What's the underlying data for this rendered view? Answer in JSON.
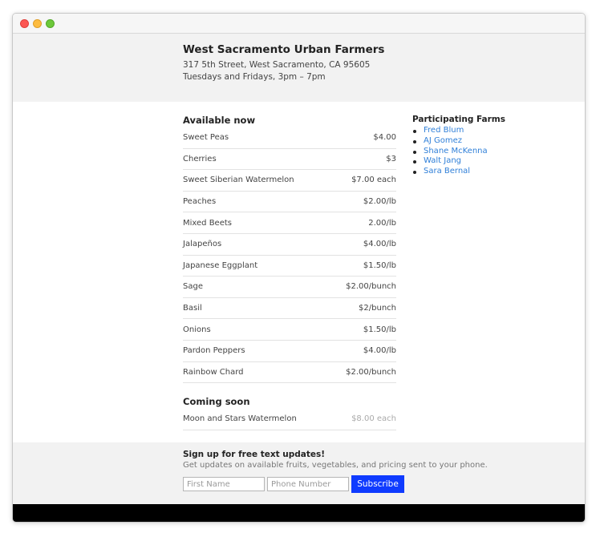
{
  "header": {
    "title": "West Sacramento Urban Farmers",
    "address": "317 5th Street, West Sacramento, CA 95605",
    "hours": "Tuesdays and Fridays, 3pm – 7pm"
  },
  "available": {
    "title": "Available now",
    "items": [
      {
        "name": "Sweet Peas",
        "price": "$4.00"
      },
      {
        "name": "Cherries",
        "price": "$3"
      },
      {
        "name": "Sweet Siberian Watermelon",
        "price": "$7.00 each"
      },
      {
        "name": "Peaches",
        "price": "$2.00/lb"
      },
      {
        "name": "Mixed Beets",
        "price": "2.00/lb"
      },
      {
        "name": "Jalapeños",
        "price": "$4.00/lb"
      },
      {
        "name": "Japanese Eggplant",
        "price": "$1.50/lb"
      },
      {
        "name": "Sage",
        "price": "$2.00/bunch"
      },
      {
        "name": "Basil",
        "price": "$2/bunch"
      },
      {
        "name": "Onions",
        "price": "$1.50/lb"
      },
      {
        "name": "Pardon Peppers",
        "price": "$4.00/lb"
      },
      {
        "name": "Rainbow Chard",
        "price": "$2.00/bunch"
      }
    ]
  },
  "coming_soon": {
    "title": "Coming soon",
    "items": [
      {
        "name": "Moon and Stars Watermelon",
        "price": "$8.00 each"
      }
    ]
  },
  "farms": {
    "title": "Participating Farms",
    "items": [
      "Fred Blum",
      "AJ Gomez",
      "Shane McKenna",
      "Walt Jang",
      "Sara Bernal"
    ]
  },
  "signup": {
    "title": "Sign up for free text updates!",
    "description": "Get updates on available fruits, vegetables, and pricing sent to your phone.",
    "first_name_placeholder": "First Name",
    "phone_placeholder": "Phone Number",
    "button_label": "Subscribe"
  },
  "colors": {
    "link": "#2f7fd8",
    "button": "#0f3bff",
    "footer": "#000000",
    "band": "#f2f2f2"
  }
}
